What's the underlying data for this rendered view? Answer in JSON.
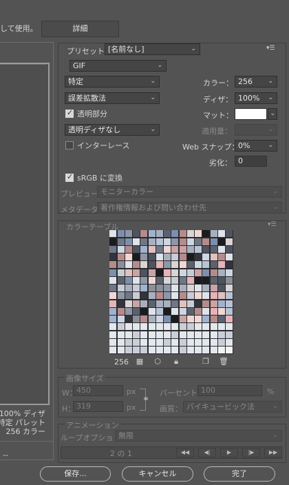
{
  "top": {
    "use_text": "して使用。",
    "detail_button": "詳細"
  },
  "left_info": {
    "dither": "100% ディザ",
    "palette": "特定 パレット",
    "colors": "256 カラー",
    "bottom": "--"
  },
  "preset": {
    "label": "プリセット：",
    "value": "[名前なし]"
  },
  "format": {
    "value": "GIF"
  },
  "reduction": {
    "value": "特定"
  },
  "dither_algo": {
    "value": "誤差拡散法"
  },
  "transparency": {
    "label": "透明部分",
    "checked": true
  },
  "transparent_dither": {
    "value": "透明ディザなし"
  },
  "interlace": {
    "label": "インターレース",
    "checked": false
  },
  "colors": {
    "label": "カラー：",
    "value": "256"
  },
  "dither": {
    "label": "ディザ：",
    "value": "100%"
  },
  "matte": {
    "label": "マット：",
    "color": "#ffffff"
  },
  "amount": {
    "label": "適用量：",
    "value": ""
  },
  "websnap": {
    "label": "Web スナップ：",
    "value": "0%"
  },
  "lossy": {
    "label": "劣化：",
    "value": "0"
  },
  "srgb": {
    "label": "sRGB に変換",
    "checked": true
  },
  "preview": {
    "label": "プレビュー：",
    "value": "モニターカラー"
  },
  "metadata": {
    "label": "メタデータ：",
    "value": "著作権情報および問い合わせ先"
  },
  "color_table": {
    "title": "カラーテーブル",
    "count": "256"
  },
  "image_size": {
    "title": "画像サイズ",
    "w_label": "W：",
    "w_value": "450",
    "w_unit": "px",
    "h_label": "H：",
    "h_value": "319",
    "h_unit": "px",
    "percent_label": "パーセント：",
    "percent_value": "100",
    "percent_unit": "%",
    "quality_label": "画質：",
    "quality_value": "バイキュービック法"
  },
  "animation": {
    "title": "アニメーション",
    "loop_label": "ループオプション：",
    "loop_value": "無限",
    "frame": "2 の 1"
  },
  "buttons": {
    "save": "保存...",
    "cancel": "キャンセル",
    "done": "完了"
  },
  "icons": {
    "menu": "menu-icon",
    "chevron": "chevron-down-icon"
  }
}
